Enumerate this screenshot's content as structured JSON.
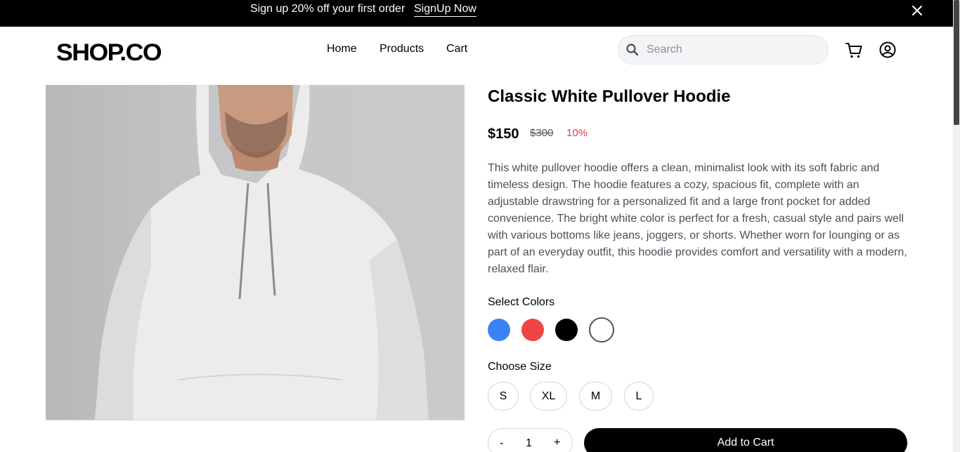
{
  "promo": {
    "text": "Sign up 20% off your first order",
    "link": "SignUp Now",
    "close_icon": "close-icon"
  },
  "header": {
    "logo": "SHOP.CO",
    "nav": [
      "Home",
      "Products",
      "Cart"
    ],
    "search_placeholder": "Search",
    "icons": [
      "search-icon",
      "cart-icon",
      "user-icon"
    ]
  },
  "product": {
    "title": "Classic White Pullover Hoodie",
    "price": "$150",
    "old_price": "$300",
    "discount": "10%",
    "description": "This white pullover hoodie offers a clean, minimalist look with its soft fabric and timeless design. The hoodie features a cozy, spacious fit, complete with an adjustable drawstring for a personalized fit and a large front pocket for added convenience. The bright white color is perfect for a fresh, casual style and pairs well with various bottoms like jeans, joggers, or shorts. Whether worn for lounging or as part of an everyday outfit, this hoodie provides comfort and versatility with a modern, relaxed flair.",
    "colors_label": "Select Colors",
    "colors": [
      "#3b82f6",
      "#ef4444",
      "#000000",
      "#ffffff"
    ],
    "selected_color": "#ffffff",
    "size_label": "Choose Size",
    "sizes": [
      "S",
      "XL",
      "M",
      "L"
    ],
    "quantity": {
      "minus": "-",
      "value": "1",
      "plus": "+"
    },
    "add_to_cart": "Add to Cart"
  }
}
